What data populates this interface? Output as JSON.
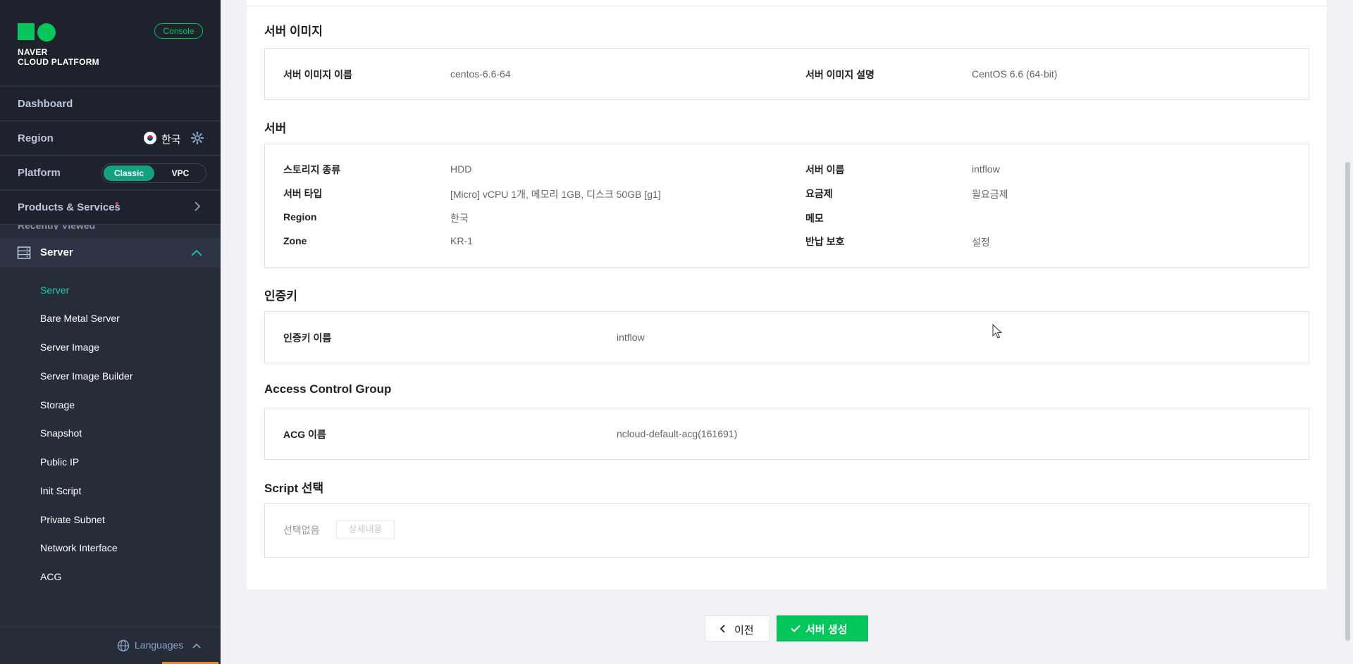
{
  "sidebar": {
    "brand_line1": "NAVER",
    "brand_line2": "CLOUD PLATFORM",
    "console_label": "Console",
    "dashboard_label": "Dashboard",
    "region_label": "Region",
    "region_value": "한국",
    "platform_label": "Platform",
    "platform_options": [
      "Classic",
      "VPC"
    ],
    "platform_selected": "Classic",
    "products_label": "Products & Services",
    "recently_viewed_label": "Recently Viewed",
    "server_group_label": "Server",
    "sub_items": [
      "Server",
      "Bare Metal Server",
      "Server Image",
      "Server Image Builder",
      "Storage",
      "Snapshot",
      "Public IP",
      "Init Script",
      "Private Subnet",
      "Network Interface",
      "ACG"
    ],
    "active_sub_item": "Server",
    "languages_label": "Languages"
  },
  "sections": {
    "image": {
      "title": "서버 이미지",
      "image_name_key": "서버 이미지 이름",
      "image_name_value": "centos-6.6-64",
      "image_desc_key": "서버 이미지 설명",
      "image_desc_value": "CentOS 6.6 (64-bit)"
    },
    "server": {
      "title": "서버",
      "storage_key": "스토리지 종류",
      "storage_value": "HDD",
      "type_key": "서버 타입",
      "type_value": "[Micro] vCPU 1개, 메모리 1GB, 디스크 50GB [g1]",
      "region_key": "Region",
      "region_value": "한국",
      "zone_key": "Zone",
      "zone_value": "KR-1",
      "name_key": "서버 이름",
      "name_value": "intflow",
      "plan_key": "요금제",
      "plan_value": "월요금제",
      "memo_key": "메모",
      "memo_value": "",
      "protect_key": "반납 보호",
      "protect_value": "설정"
    },
    "auth": {
      "title": "인증키",
      "key_name_key": "인증키 이름",
      "key_name_value": "intflow"
    },
    "acg": {
      "title": "Access Control Group",
      "acg_name_key": "ACG 이름",
      "acg_name_value": "ncloud-default-acg(161691)"
    },
    "script": {
      "title": "Script 선택",
      "selected_value": "선택없음",
      "detail_button": "상세내용"
    }
  },
  "actions": {
    "prev_label": "이전",
    "create_label": "서버 생성"
  },
  "colors": {
    "brand_green": "#03c75a",
    "active_teal": "#1bc8aa",
    "toggle_teal": "#11a27f",
    "sidebar_bg": "#262c38"
  }
}
